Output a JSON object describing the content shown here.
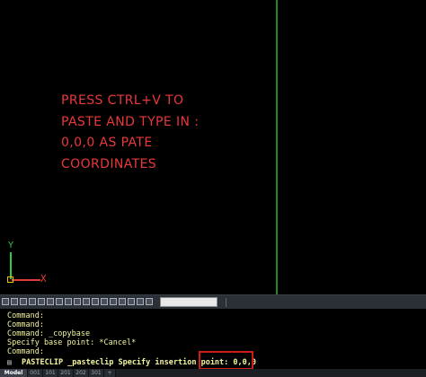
{
  "canvas": {
    "note_lines": [
      "PRESS CTRL+V TO",
      "PASTE AND TYPE IN :",
      "0,0,0 AS PATE",
      "COORDINATES"
    ],
    "ucs": {
      "y_label": "Y",
      "x_label": "X"
    },
    "colors": {
      "background": "#000000",
      "note": "#e8383a",
      "grid_line": "#1f8a1f"
    }
  },
  "command_history": [
    "Command:",
    "Command:",
    "Command: _copybase",
    "Specify base point: *Cancel*",
    "Command:"
  ],
  "command_prompt": {
    "icon": "command-line-icon",
    "text": "PASTECLIP _pasteclip Specify insertion point: 0,0,0"
  },
  "layout_tabs": [
    "Model",
    "001",
    "101",
    "201",
    "202",
    "301",
    "+"
  ],
  "toolbar": {
    "icons": [
      "layer-icon",
      "layer-icon",
      "layer-icon",
      "layer-icon",
      "layer-icon",
      "layer-icon",
      "layer-icon",
      "layer-icon",
      "layer-icon",
      "layer-icon",
      "layer-icon",
      "layer-icon",
      "layer-icon",
      "layer-icon",
      "layer-icon",
      "layer-icon",
      "layer-icon",
      "layer-icon",
      "layer-icon"
    ]
  }
}
